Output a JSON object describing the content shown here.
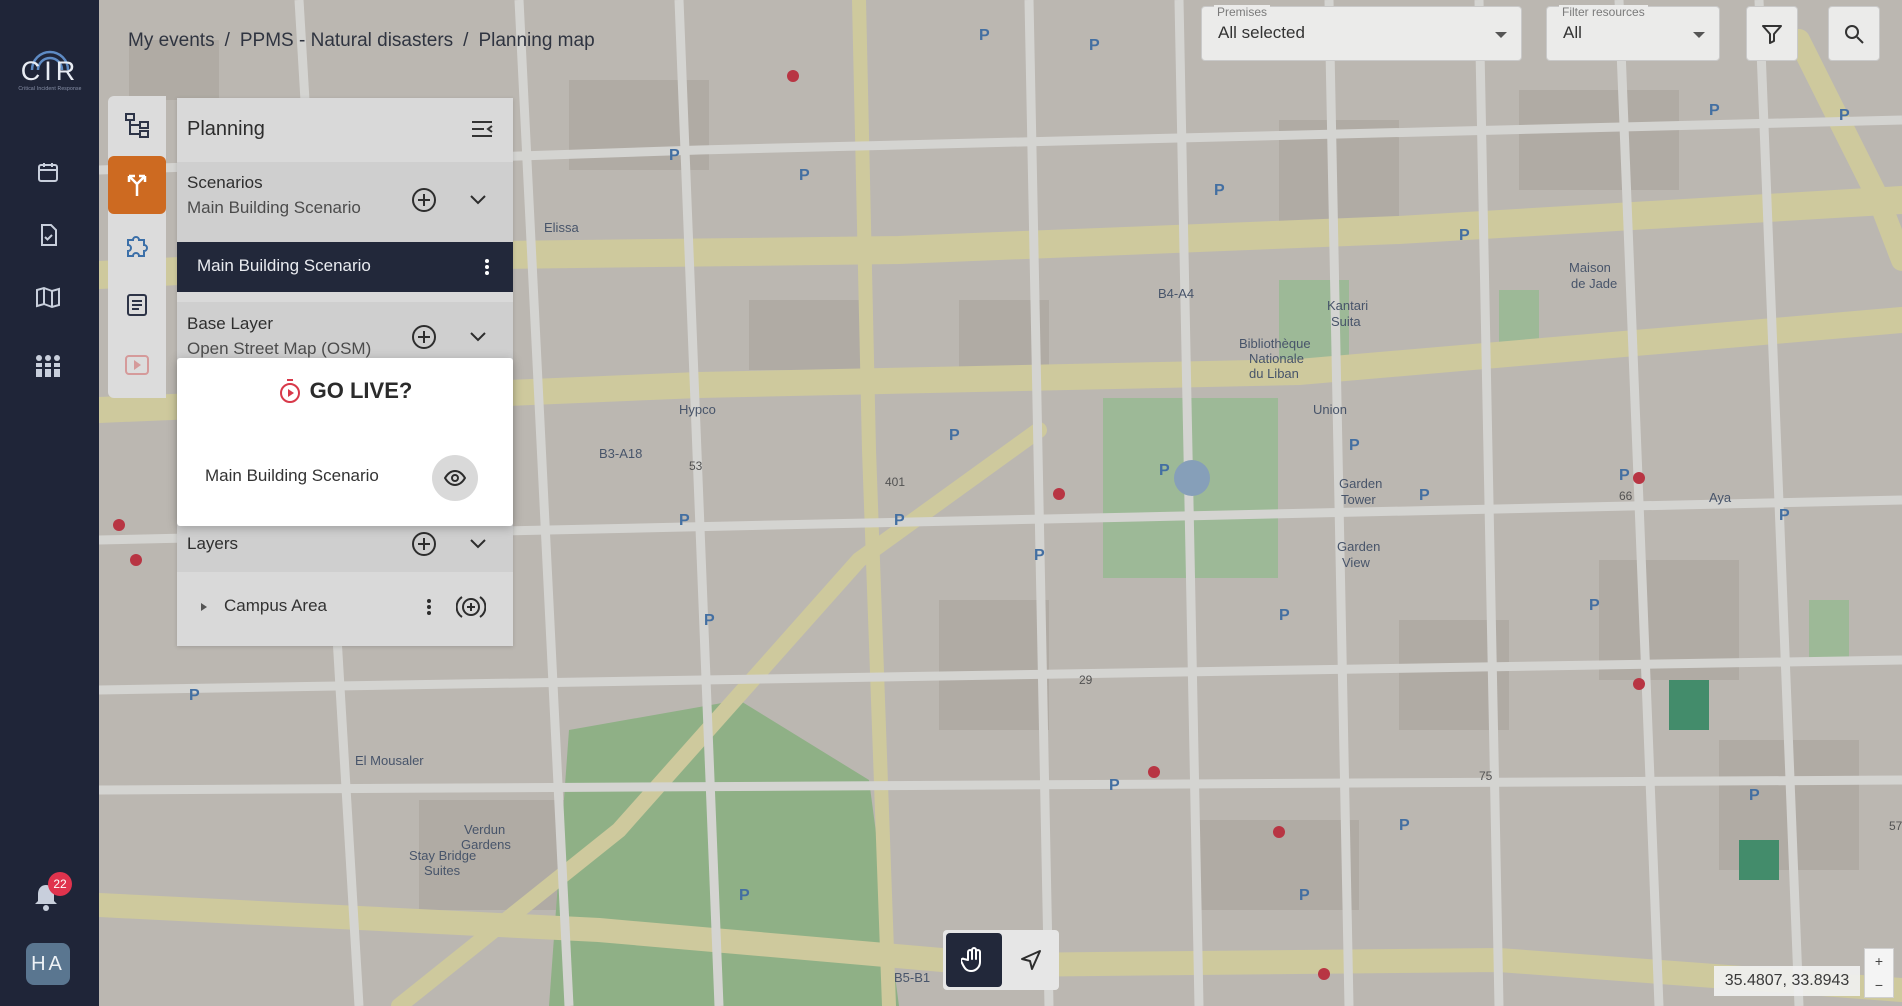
{
  "app": {
    "logo_text": "CIR",
    "logo_sub": "Critical Incident Response"
  },
  "nav": {
    "items": [
      {
        "name": "calendar"
      },
      {
        "name": "checklist"
      },
      {
        "name": "map"
      },
      {
        "name": "teams"
      }
    ],
    "notifications_count": "22",
    "avatar_initials": "HA"
  },
  "breadcrumb": [
    "My events",
    "PPMS - Natural disasters",
    "Planning map"
  ],
  "filters": {
    "premises_label": "Premises",
    "premises_value": "All selected",
    "resources_label": "Filter resources",
    "resources_value": "All"
  },
  "panel": {
    "title": "Planning",
    "scenarios_label": "Scenarios",
    "scenarios_selected": "Main Building Scenario",
    "scenario_item": "Main Building Scenario",
    "base_layer_label": "Base Layer",
    "base_layer_value": "Open Street Map (OSM)",
    "layers_label": "Layers",
    "layer_item": "Campus Area"
  },
  "modal": {
    "title": "GO LIVE?",
    "item": "Main Building Scenario"
  },
  "map": {
    "coords": "35.4807, 33.8943",
    "labels": [
      "Elissa",
      "Hypco",
      "B3-A18",
      "B4-A4",
      "Kantari Suita",
      "Maison de Jade",
      "Union",
      "Bibliothèque Nationale du Liban",
      "Garden Tower",
      "Garden View",
      "Aya",
      "El Mousaler",
      "Verdun Gardens",
      "Stay Bridge Suites",
      "B5-B1",
      "53",
      "401",
      "29",
      "75",
      "66",
      "57"
    ]
  },
  "colors": {
    "nav_bg": "#1f2538",
    "accent": "#cd6a21",
    "map_bg": "#d8d3cc",
    "road": "#f7f3d9"
  }
}
